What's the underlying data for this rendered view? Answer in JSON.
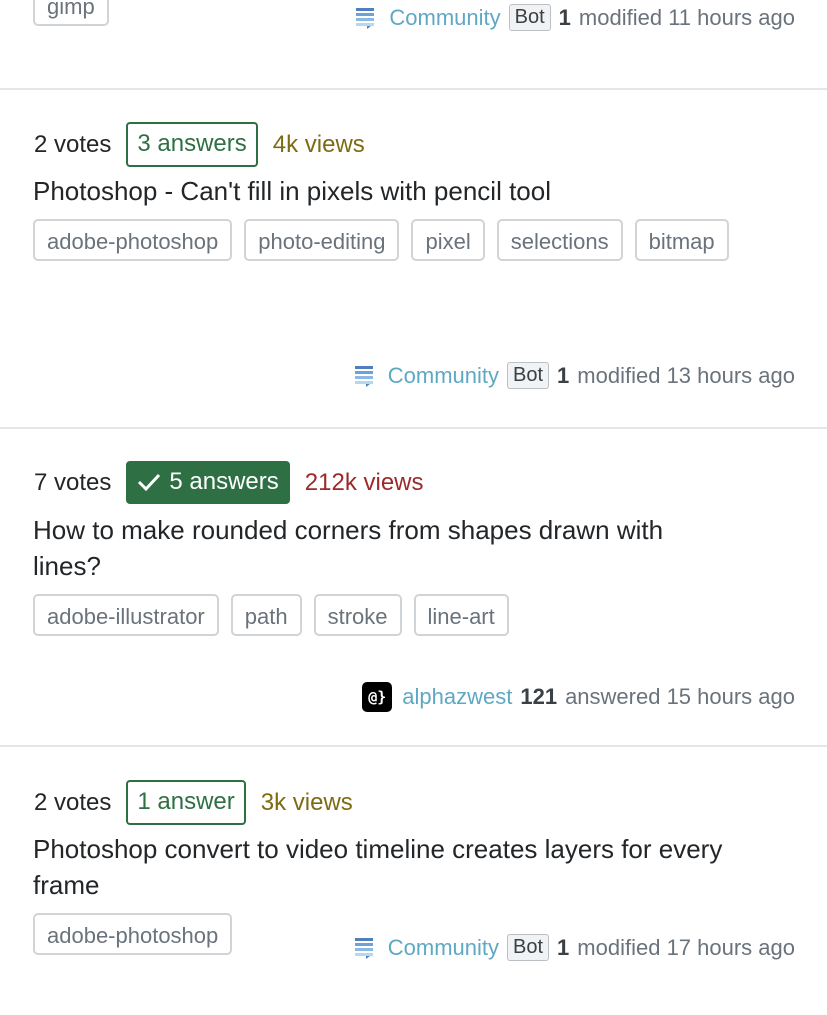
{
  "top_partial": {
    "tags": [
      "gimp"
    ],
    "meta": {
      "user": "Community",
      "badge": "Bot",
      "rep": "1",
      "action": "modified 11 hours ago"
    }
  },
  "questions": [
    {
      "votes": "2 votes",
      "answers": "3 answers",
      "accepted": false,
      "views": "4k views",
      "title": "Photoshop - Can't fill in pixels with pencil tool",
      "tags": [
        "adobe-photoshop",
        "photo-editing",
        "pixel",
        "selections",
        "bitmap"
      ],
      "meta": {
        "user": "Community",
        "badge": "Bot",
        "rep": "1",
        "action": "modified 13 hours ago"
      }
    },
    {
      "votes": "7 votes",
      "answers": "5 answers",
      "accepted": true,
      "views": "212k views",
      "title": "How to make rounded corners from shapes drawn with lines?",
      "tags": [
        "adobe-illustrator",
        "path",
        "stroke",
        "line-art"
      ],
      "meta": {
        "user": "alphazwest",
        "avatar_text": "@}",
        "rep": "121",
        "action": "answered 15 hours ago"
      }
    },
    {
      "votes": "2 votes",
      "answers": "1 answer",
      "accepted": false,
      "views": "3k views",
      "title": "Photoshop convert to video timeline creates layers for every frame",
      "tags": [
        "adobe-photoshop"
      ],
      "meta": {
        "user": "Community",
        "badge": "Bot",
        "rep": "1",
        "action": "modified 17 hours ago"
      }
    }
  ],
  "colors": {
    "answered": "#2f6f44",
    "views_warm": "#7d6b13",
    "views_hot": "#9b2a2a",
    "user_link": "#5fa8c4"
  }
}
